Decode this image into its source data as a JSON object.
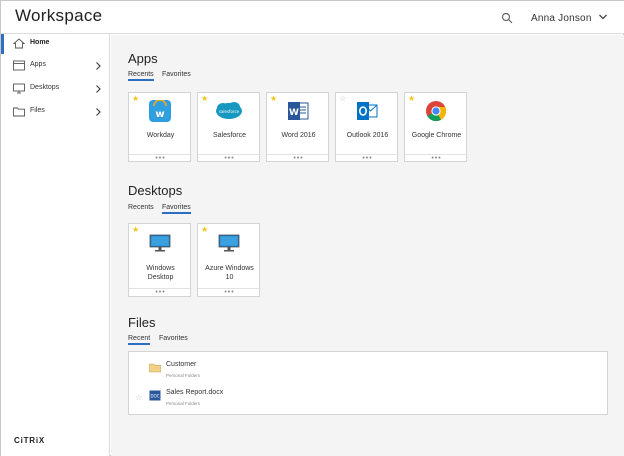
{
  "header": {
    "title": "Workspace",
    "user_name": "Anna Jonson",
    "search_icon": "search-icon",
    "chevron_icon": "chevron-down-icon"
  },
  "sidebar": {
    "items": [
      {
        "label": "Home",
        "icon": "home-icon",
        "active": true
      },
      {
        "label": "Apps",
        "icon": "apps-window-icon",
        "active": false
      },
      {
        "label": "Desktops",
        "icon": "monitor-icon",
        "active": false
      },
      {
        "label": "Files",
        "icon": "folder-icon",
        "active": false
      }
    ],
    "logo": "CiTRiX"
  },
  "apps": {
    "title": "Apps",
    "tabs": [
      "Recents",
      "Favorites"
    ],
    "selected_tab": "Recents",
    "tiles": [
      {
        "label": "Workday",
        "icon": "workday-icon",
        "favorite": true
      },
      {
        "label": "Salesforce",
        "icon": "salesforce-icon",
        "favorite": true
      },
      {
        "label": "Word 2016",
        "icon": "word-icon",
        "favorite": true
      },
      {
        "label": "Outlook 2016",
        "icon": "outlook-icon",
        "favorite": false
      },
      {
        "label": "Google Chrome",
        "icon": "chrome-icon",
        "favorite": true
      }
    ],
    "more_label": "•••"
  },
  "desktops": {
    "title": "Desktops",
    "tabs": [
      "Recents",
      "Favorites"
    ],
    "selected_tab": "Favorites",
    "tiles": [
      {
        "label_line1": "Windows",
        "label_line2": "Desktop",
        "icon": "monitor-icon",
        "favorite": true
      },
      {
        "label_line1": "Azure Windows",
        "label_line2": "10",
        "icon": "monitor-icon",
        "favorite": true
      }
    ],
    "more_label": "•••"
  },
  "files": {
    "title": "Files",
    "tabs": [
      "Recent",
      "Favorites"
    ],
    "selected_tab": "Recent",
    "items": [
      {
        "name": "Customer",
        "location": "Personal Folders",
        "icon": "folder-icon"
      },
      {
        "name": "Sales Report.docx",
        "location": "Personal Folders",
        "icon": "docx-icon"
      }
    ]
  },
  "colors": {
    "accent": "#2a6fc2",
    "star": "#f0c419",
    "background": "#f4f4f4"
  }
}
